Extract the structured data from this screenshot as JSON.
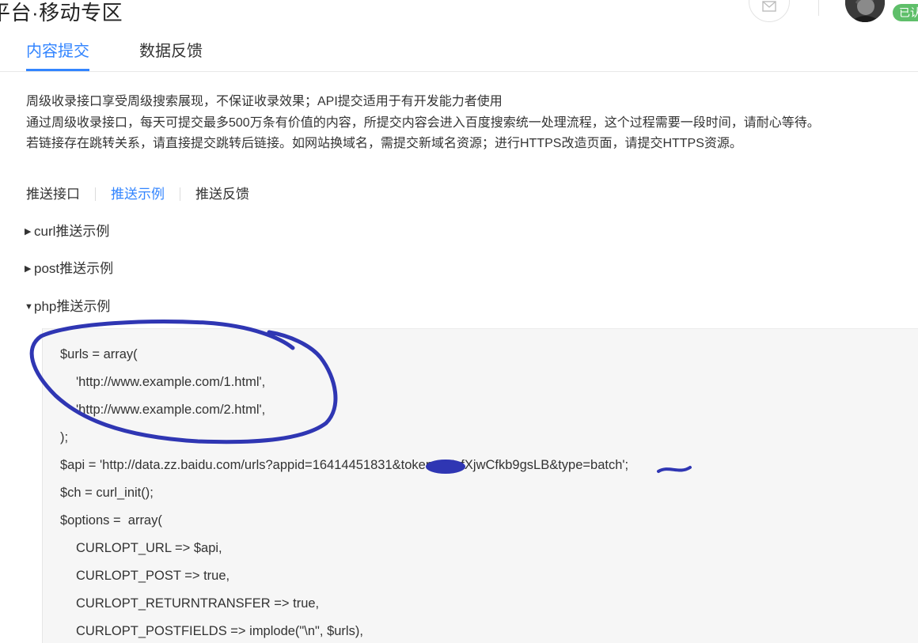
{
  "header": {
    "title": "平台·移动专区",
    "icons": {
      "message": "envelope-icon",
      "avatar": "user-avatar"
    },
    "badge": "已认"
  },
  "tabs": [
    {
      "label": "内容提交",
      "active": true
    },
    {
      "label": "数据反馈",
      "active": false
    }
  ],
  "description": [
    "周级收录接口享受周级搜索展现，不保证收录效果；API提交适用于有开发能力者使用",
    "通过周级收录接口，每天可提交最多500万条有价值的内容，所提交内容会进入百度搜索统一处理流程，这个过程需要一段时间，请耐心等待。",
    "若链接存在跳转关系，请直接提交跳转后链接。如网站换域名，需提交新域名资源；进行HTTPS改造页面，请提交HTTPS资源。"
  ],
  "subtabs": [
    {
      "label": "推送接口",
      "active": false
    },
    {
      "label": "推送示例",
      "active": true
    },
    {
      "label": "推送反馈",
      "active": false
    }
  ],
  "sections": [
    {
      "label": "curl推送示例",
      "expanded": false,
      "arrow": "▶"
    },
    {
      "label": "post推送示例",
      "expanded": false,
      "arrow": "▶"
    },
    {
      "label": "php推送示例",
      "expanded": true,
      "arrow": "▼"
    }
  ],
  "code": {
    "lines": [
      "$urls = array(",
      "'http://www.example.com/1.html',",
      "'http://www.example.com/2.html',",
      ");",
      "$api = 'http://data.zz.baidu.com/urls?appid=16414451831&token=0BrfXjwCfkb9gsLB&type=batch';",
      "$ch = curl_init();",
      "$options =  array(",
      "CURLOPT_URL => $api,",
      "CURLOPT_POST => true,",
      "CURLOPT_RETURNTRANSFER => true,",
      "CURLOPT_POSTFIELDS => implode(\"\\n\", $urls),"
    ]
  },
  "colors": {
    "accent": "#3385ff",
    "text": "#333333",
    "code_bg": "#f6f6f6",
    "annotation": "#2f36b3",
    "badge": "#5fbf6a"
  }
}
